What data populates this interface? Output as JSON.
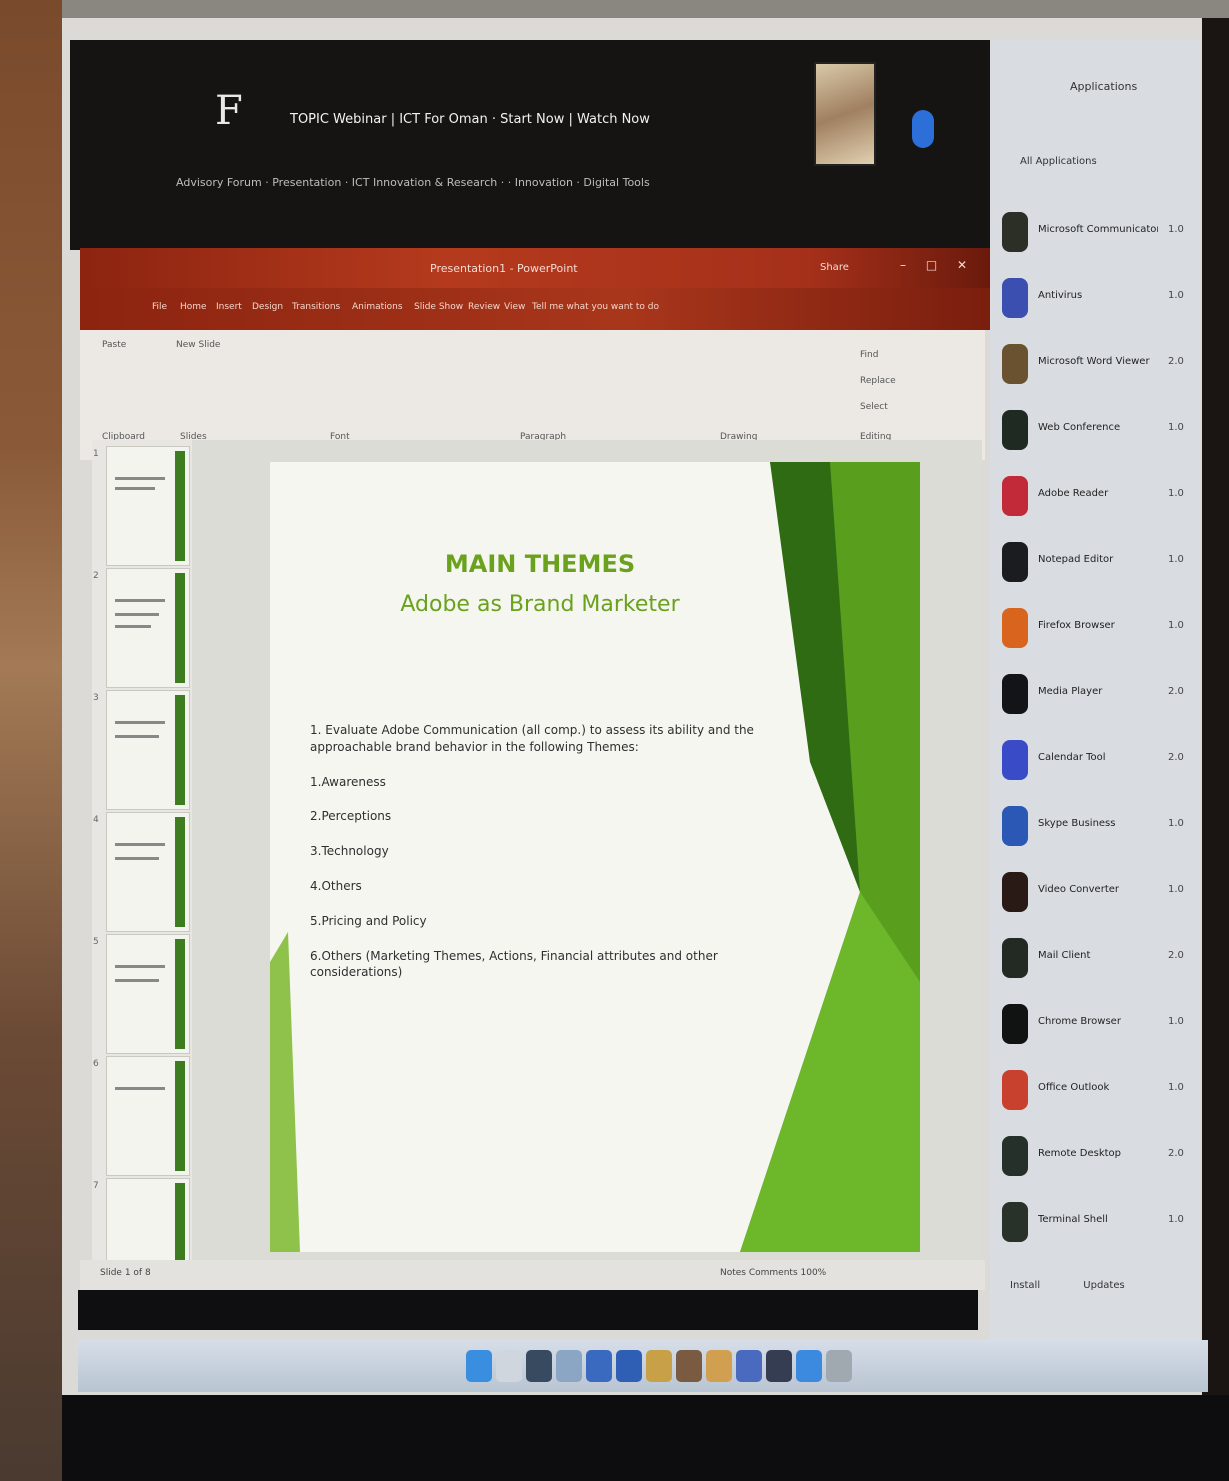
{
  "video_header": {
    "letter": "F",
    "title": "TOPIC Webinar | ICT For Oman · Start Now | Watch Now",
    "subtitle": "Advisory Forum · Presentation · ICT Innovation & Research · · Innovation · Digital Tools"
  },
  "ppt": {
    "window_title": "Presentation1 - PowerPoint",
    "user": "Share",
    "window_controls": "– □ ✕",
    "tabs": [
      "File",
      "Home",
      "Insert",
      "Design",
      "Transitions",
      "Animations",
      "Slide Show",
      "Review",
      "View",
      "Tell me what you want to do"
    ],
    "ribbon_groups": [
      "Paste",
      "Clipboard",
      "New Slide",
      "Slides",
      "Font",
      "Paragraph",
      "Drawing",
      "Editing",
      "Find",
      "Replace",
      "Select"
    ],
    "status_left": "Slide 1 of 8",
    "status_right": "Notes  Comments  100%"
  },
  "slide": {
    "title": "MAIN THEMES",
    "subtitle": "Adobe as Brand Marketer",
    "bullets": [
      "1. Evaluate Adobe Communication (all comp.) to assess its ability and the approachable brand behavior in the following Themes:",
      "1.Awareness",
      "2.Perceptions",
      "3.Technology",
      "4.Others",
      "5.Pricing and Policy",
      "6.Others (Marketing Themes, Actions, Financial attributes and other considerations)"
    ]
  },
  "thumbnails": [
    "1",
    "2",
    "3",
    "4",
    "5",
    "6",
    "7"
  ],
  "right_panel": {
    "header": "Applications",
    "filter": "All Applications",
    "apps": [
      {
        "name": "Microsoft Communicator",
        "version": "1.0",
        "color": "#2b2f26"
      },
      {
        "name": "Antivirus",
        "version": "1.0",
        "color": "#3b4fb0"
      },
      {
        "name": "Microsoft Word Viewer",
        "version": "2.0",
        "color": "#6a5230"
      },
      {
        "name": "Web Conference",
        "version": "1.0",
        "color": "#1f2a22"
      },
      {
        "name": "Adobe Reader",
        "version": "1.0",
        "color": "#c22a3a"
      },
      {
        "name": "Notepad Editor",
        "version": "1.0",
        "color": "#1a1c20"
      },
      {
        "name": "Firefox Browser",
        "version": "1.0",
        "color": "#d8641e"
      },
      {
        "name": "Media Player",
        "version": "2.0",
        "color": "#121418"
      },
      {
        "name": "Calendar Tool",
        "version": "2.0",
        "color": "#3a4bc8"
      },
      {
        "name": "Skype Business",
        "version": "1.0",
        "color": "#2b58b4"
      },
      {
        "name": "Video Converter",
        "version": "1.0",
        "color": "#2a1a16"
      },
      {
        "name": "Mail Client",
        "version": "2.0",
        "color": "#232a24"
      },
      {
        "name": "Chrome Browser",
        "version": "1.0",
        "color": "#111212"
      },
      {
        "name": "Office Outlook",
        "version": "1.0",
        "color": "#c8402e"
      },
      {
        "name": "Remote Desktop",
        "version": "2.0",
        "color": "#26302a"
      },
      {
        "name": "Terminal Shell",
        "version": "1.0",
        "color": "#283228"
      }
    ],
    "footer": "Install Updates"
  },
  "dock_colors": [
    "#3a8ee0",
    "#cfd6de",
    "#384a60",
    "#8aa6c4",
    "#3a6ac0",
    "#2f5fb4",
    "#c8a048",
    "#7a5a40",
    "#d0a050",
    "#4a6ac0",
    "#343d52",
    "#3c8ae0",
    "#a0a8b0"
  ]
}
